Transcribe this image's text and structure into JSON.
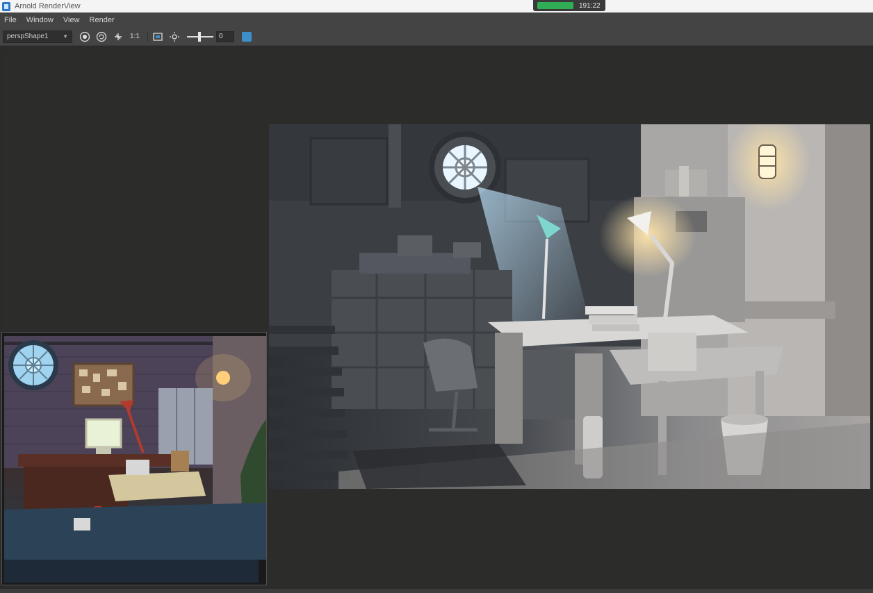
{
  "window": {
    "title": "Arnold RenderView",
    "timer": "191:22"
  },
  "menu": [
    "File",
    "Window",
    "View",
    "Render"
  ],
  "toolbar": {
    "camera": "perspShape1",
    "ratio_label": "1:1",
    "exposure_value": "0"
  },
  "icons": {
    "app": "arnold-app-icon",
    "render": "render-icon",
    "ipr": "ipr-refresh-icon",
    "crop": "crop-region-icon",
    "display": "display-window-icon",
    "exposure": "exposure-sun-icon",
    "snapshot": "snapshot-icon"
  },
  "colors": {
    "timer_green": "#2fae55",
    "ui_bg": "#444444",
    "view_bg": "#2c2d2b",
    "light_warm": "#ffd38a",
    "light_cool": "#bfe6ff",
    "lamp_teal": "#7fd6cf"
  }
}
